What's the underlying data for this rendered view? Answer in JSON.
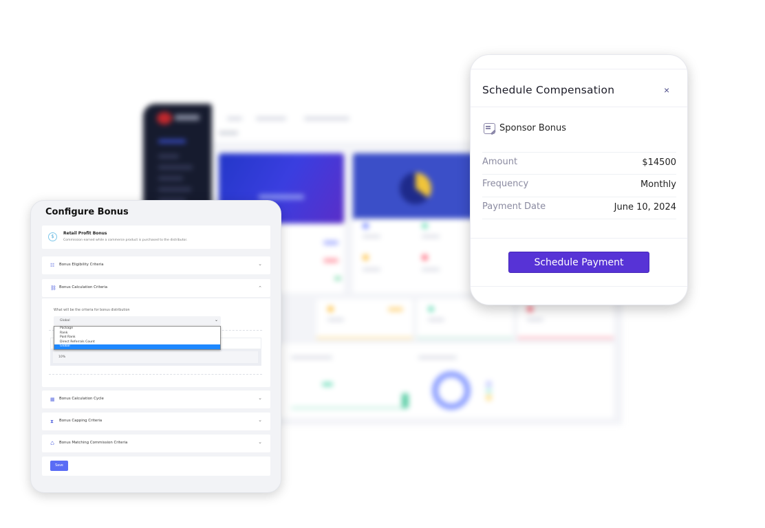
{
  "schedule_modal": {
    "title": "Schedule Compensation",
    "close_icon": "×",
    "bonus_name": "Sponsor Bonus",
    "rows": [
      {
        "label": "Amount",
        "value": "$14500"
      },
      {
        "label": "Frequency",
        "value": "Monthly"
      },
      {
        "label": "Payment Date",
        "value": "June 10, 2024"
      }
    ],
    "button_label": "Schedule Payment",
    "accent": "#5733d6"
  },
  "configure_panel": {
    "title": "Configure Bonus",
    "bonus": {
      "title": "Retail Profit Bonus",
      "description": "Commission earned while a commerce product is purchased to the distributor."
    },
    "sections": [
      {
        "label": "Bonus Eligibility Criteria",
        "icon": "list-icon",
        "glyph": "☷",
        "chevron": "⌄",
        "expanded": false
      },
      {
        "label": "Bonus Calculation Criteria",
        "icon": "link-icon",
        "glyph": "⛓",
        "chevron": "⌃",
        "expanded": true
      },
      {
        "label": "Bonus Calculation Cycle",
        "icon": "calendar-icon",
        "glyph": "▦",
        "chevron": "⌄",
        "expanded": false
      },
      {
        "label": "Bonus Capping Criteria",
        "icon": "hourglass-icon",
        "glyph": "⧗",
        "chevron": "⌄",
        "expanded": false
      },
      {
        "label": "Bonus Matching Commission Criteria",
        "icon": "recycle-icon",
        "glyph": "♺",
        "chevron": "⌄",
        "expanded": false
      }
    ],
    "calculation": {
      "question": "What will be the criteria for bonus distribution",
      "selected": "Global",
      "chevron": "⌄",
      "options": [
        "Package",
        "Rank",
        "Paid Rank",
        "Direct Referrals Count",
        "Global"
      ],
      "percentage_value": "10%"
    },
    "save_label": "Save",
    "accent": "#5a6cf5"
  }
}
